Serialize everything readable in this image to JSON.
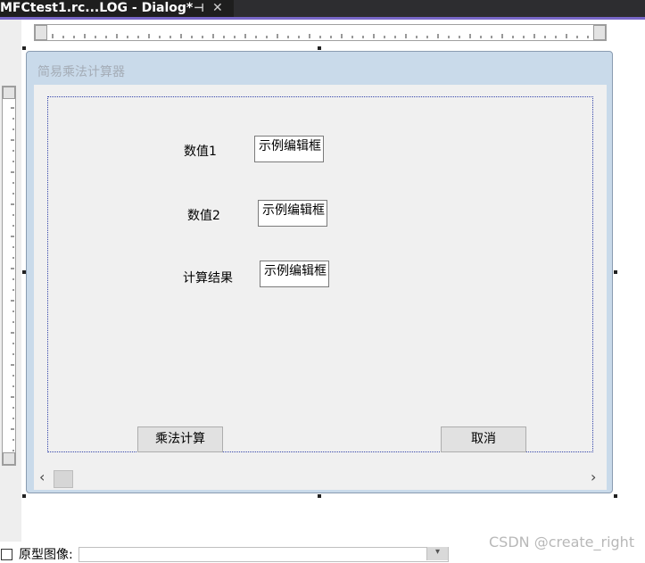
{
  "tab": {
    "title": "MFCtest1.rc...LOG - Dialog*",
    "pin_glyph": "⊣",
    "close_glyph": "✕"
  },
  "dialog": {
    "title": "简易乘法计算器",
    "fields": [
      {
        "label": "数值1",
        "edit_text": "示例编辑框"
      },
      {
        "label": "数值2",
        "edit_text": "示例编辑框"
      },
      {
        "label": "计算结果",
        "edit_text": "示例编辑框"
      }
    ],
    "buttons": {
      "multiply_label": "乘法计算",
      "cancel_label": "取消"
    }
  },
  "scrollbar": {
    "left_glyph": "‹",
    "right_glyph": "›"
  },
  "footer": {
    "checkbox_label": "原型图像:"
  },
  "watermark": "CSDN @create_right"
}
